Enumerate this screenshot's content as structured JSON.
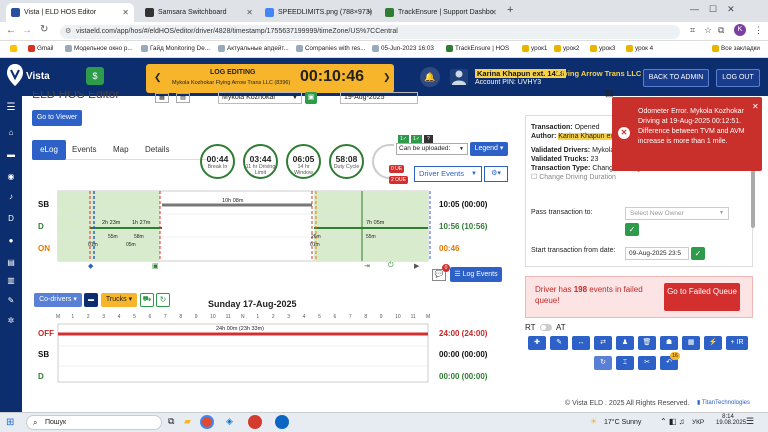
{
  "browser": {
    "tabs": [
      {
        "title": "Vista | ELD HOS Editor",
        "active": true,
        "color": "#2a4fa0"
      },
      {
        "title": "Samsara Switchboard",
        "active": false,
        "color": "#333"
      },
      {
        "title": "SPEEDLIMITS.png (788×973)",
        "active": false,
        "color": "#4285f4"
      },
      {
        "title": "TrackEnsure | Support Dashbo",
        "active": false,
        "color": "#2e7d32"
      }
    ],
    "url": "vistaeld.com/app/hos/#/eldHOS/editor/driver/4828/timestamp/1755637199999/timeZone/US%7CCentral",
    "bookmarks": [
      "Gmail",
      "Модельное окно р...",
      "Гайд Monitoring De...",
      "Актуальные апдейт...",
      "Companies with res...",
      "05-Jun-2023 16:03",
      "TrackEnsure | HOS",
      "урок1",
      "урок2",
      "урок3",
      "урок 4",
      "Все закладки"
    ]
  },
  "header": {
    "logo": "Vista",
    "log_editing_label": "LOG EDITING",
    "log_editing_sub": "Mykola Kozhokar  Flying Arrow Trans LLC (8396)",
    "timer": "00:10:46",
    "user_name": "Karina Khapun ext. 1416",
    "company": "Flying Arrow Trans LLC",
    "account": "Account PIN: UVHY3",
    "back_to_admin": "BACK TO ADMIN",
    "logout": "LOG OUT"
  },
  "editor": {
    "title": "ELD HOS Editor",
    "driver": "Mykola Kozhokar",
    "date": "19-Aug-2025",
    "go_to_viewer": "Go to Viewer",
    "tabs": [
      "eLog",
      "Events",
      "Map",
      "Details"
    ],
    "timers": [
      {
        "value": "00:44",
        "label": "Break In"
      },
      {
        "value": "03:44",
        "label": "11 hr Driving Limit"
      },
      {
        "value": "06:05",
        "label": "14 hr Window"
      },
      {
        "value": "58:08",
        "label": "Duty Cycle"
      }
    ],
    "can_be_uploaded": "Can be uploaded:",
    "legend_btn": "Legend",
    "driver_events": "Driver Events",
    "badges": [
      "0 UE",
      "2 OUE"
    ],
    "log_events_btn": "Log Events",
    "counter": "0"
  },
  "chart1": {
    "rows": [
      {
        "label": "SB",
        "value": "10:05 (00:00)",
        "color": "#111"
      },
      {
        "label": "D",
        "value": "10:56 (10:56)",
        "color": "#2e7d32"
      },
      {
        "label": "ON",
        "value": "00:46",
        "color": "#e07b00"
      }
    ],
    "segment_labels": [
      "10h 08m",
      "2h 23m",
      "1h 27m",
      "7h 05m",
      "01m",
      "05m",
      "58m",
      "55m",
      "01m",
      "55m",
      "26m"
    ]
  },
  "chart2": {
    "codrivers": "Co-drivers",
    "trucks": "Trucks",
    "date_title": "Sunday 17-Aug-2025",
    "rows": [
      {
        "label": "OFF",
        "value": "24:00 (24:00)",
        "color": "#c62828"
      },
      {
        "label": "SB",
        "value": "00:00 (00:00)",
        "color": "#111"
      },
      {
        "label": "D",
        "value": "00:00 (00:00)",
        "color": "#2e7d32"
      }
    ],
    "segment_label": "24h 00m (23h 33m)",
    "hour_ticks": [
      "M",
      "1",
      "2",
      "3",
      "4",
      "5",
      "6",
      "7",
      "8",
      "9",
      "10",
      "11",
      "N",
      "1",
      "2",
      "3",
      "4",
      "5",
      "6",
      "7",
      "8",
      "9",
      "10",
      "11",
      "M"
    ]
  },
  "transaction": {
    "status_label": "Transaction:",
    "status": "Opened",
    "author_label": "Author:",
    "author": "Karina Khapun ext",
    "validated_drivers_label": "Validated Drivers:",
    "validated_drivers": "Mykola",
    "validated_trucks_label": "Validated Trucks:",
    "validated_trucks": "23",
    "type_label": "Transaction Type:",
    "type": "Change Driving Duration",
    "type_check": "Change Driving Duration",
    "pass_label": "Pass transaction to:",
    "select_owner": "Select New Owner",
    "start_label": "Start transaction from date:",
    "start_value": "09-Aug-2025 23:5",
    "failed_text_a": "Driver has ",
    "failed_count": "198",
    "failed_text_b": " events in failed queue!",
    "goto_failed": "Go to Failed Queue",
    "rt": "RT",
    "at": "AT",
    "ir": "+ IR",
    "notif_count": "16"
  },
  "error_toast": {
    "text": "Odometer Error. Mykola Kozhokar Driving at 19-Aug-2025 00:12:51. Difference between TVM and AVM increase is more than 1 mile."
  },
  "footer": {
    "copyright": "© Vista ELD . 2025 All Rights Reserved.",
    "brand": "TitanTechnologies"
  },
  "taskbar": {
    "search": "Пошук",
    "weather": "17°C  Sunny",
    "lang": "УКР",
    "time": "8:14",
    "date": "19.08.2025"
  },
  "colors": {
    "primary": "#2d61c8",
    "header": "#0c2d6e",
    "accent": "#f6b52a",
    "error": "#c62828",
    "driving": "#2e7d32"
  }
}
